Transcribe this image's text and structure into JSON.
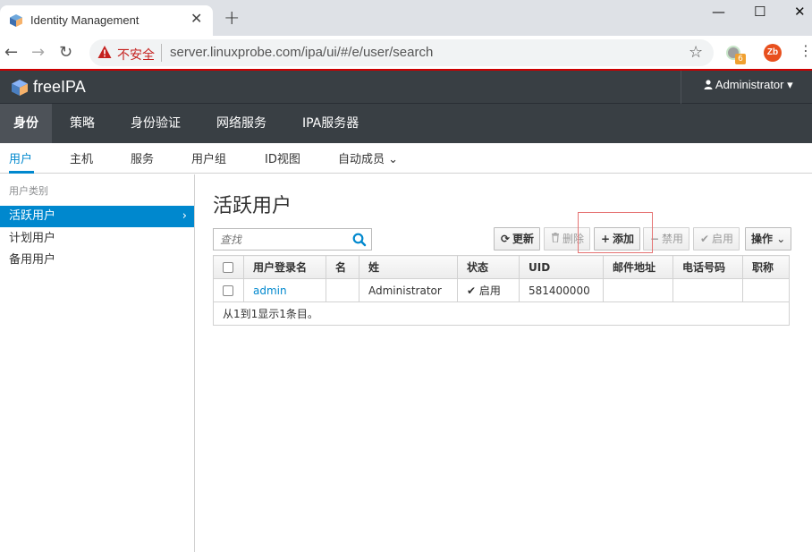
{
  "browser": {
    "tab_title": "Identity Management",
    "tab_close": "✕",
    "new_tab": "+",
    "window_controls": {
      "minimize": "—",
      "maximize": "☐",
      "close": "✕"
    },
    "nav": {
      "back": "←",
      "forward": "→",
      "reload": "↻"
    },
    "security_label": "不安全",
    "url": "server.linuxprobe.com/ipa/ui/#/e/user/search",
    "bookmark": "☆",
    "extension_badge": "6",
    "profile_initials": "Zb",
    "menu": "⋮"
  },
  "header": {
    "logo_text": "freeIPA",
    "user_menu": "Administrator",
    "user_icon": "user-icon",
    "caret": "▾"
  },
  "nav_primary": [
    {
      "label": "身份",
      "active": true
    },
    {
      "label": "策略",
      "active": false
    },
    {
      "label": "身份验证",
      "active": false
    },
    {
      "label": "网络服务",
      "active": false
    },
    {
      "label": "IPA服务器",
      "active": false
    }
  ],
  "nav_secondary": [
    {
      "label": "用户",
      "active": true
    },
    {
      "label": "主机",
      "active": false
    },
    {
      "label": "服务",
      "active": false
    },
    {
      "label": "用户组",
      "active": false
    },
    {
      "label": "ID视图",
      "active": false
    },
    {
      "label": "自动成员 ⌄",
      "active": false
    }
  ],
  "sidebar": {
    "header": "用户类别",
    "items": [
      {
        "label": "活跃用户",
        "active": true,
        "chevron": "›"
      },
      {
        "label": "计划用户",
        "active": false
      },
      {
        "label": "备用用户",
        "active": false
      }
    ]
  },
  "main": {
    "title": "活跃用户",
    "search_placeholder": "查找",
    "buttons": {
      "refresh": {
        "icon": "⟳",
        "label": "更新"
      },
      "delete": {
        "icon": "🗑",
        "label": "删除"
      },
      "add": {
        "icon": "+",
        "label": "添加"
      },
      "disable": {
        "icon": "−",
        "label": "禁用"
      },
      "enable": {
        "icon": "✔",
        "label": "启用"
      },
      "actions": {
        "label": "操作",
        "caret": "⌄"
      }
    },
    "table": {
      "columns": [
        "用户登录名",
        "名",
        "姓",
        "状态",
        "UID",
        "邮件地址",
        "电话号码",
        "职称"
      ],
      "rows": [
        {
          "login": "admin",
          "first": "",
          "last": "Administrator",
          "status_icon": "✔",
          "status": "启用",
          "uid": "581400000",
          "email": "",
          "phone": "",
          "title": ""
        }
      ],
      "footer": "从1到1显示1条目。"
    }
  }
}
